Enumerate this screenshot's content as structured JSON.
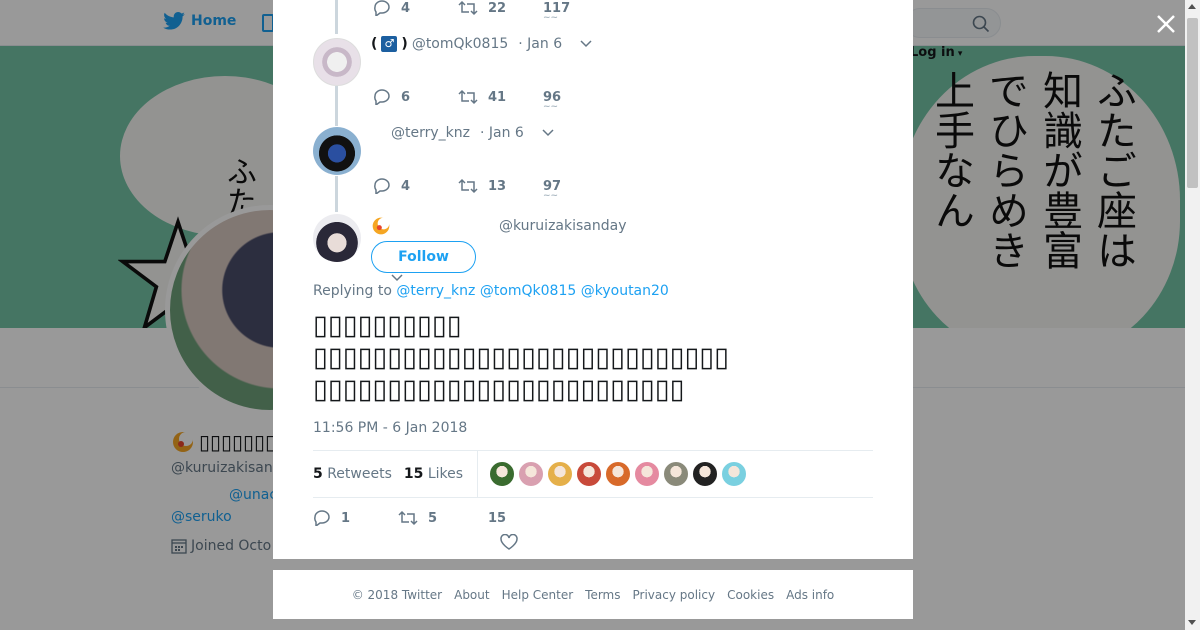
{
  "background": {
    "nav": {
      "home_label": "Home",
      "login_label": "Log in"
    },
    "banner_text_left": "ふた",
    "banner_text_right_cols": [
      "ふたご座は",
      "知識が豊富",
      "でひらめき",
      "上手なん"
    ],
    "profile": {
      "name_suffix": "▯▯▯▯▯▯▯",
      "handle": "@kuruizakisan",
      "link1": "@unac",
      "link2": "@seruko",
      "joined": "Joined Octo"
    }
  },
  "thread": {
    "top_actions": {
      "replies": "4",
      "retweets": "22",
      "likes": "117"
    },
    "reply1": {
      "gender_symbol": "♂",
      "handle": "@tomQk0815",
      "date": "· Jan 6",
      "replies": "6",
      "retweets": "41",
      "likes": "96"
    },
    "reply2": {
      "handle": "@terry_knz",
      "date": "· Jan 6",
      "replies": "4",
      "retweets": "13",
      "likes": "97"
    }
  },
  "tweet": {
    "handle": "@kuruizakisanday",
    "follow_label": "Follow",
    "replying_prefix": "Replying to",
    "replying_to": [
      "@terry_knz",
      "@tomQk0815",
      "@kyoutan20"
    ],
    "text": "▯▯▯▯▯▯▯▯▯▯\n▯▯▯▯▯▯▯▯▯▯▯▯▯▯▯▯▯▯▯▯▯▯▯▯▯▯▯▯\n▯▯▯▯▯▯▯▯▯▯▯▯▯▯▯▯▯▯▯▯▯▯▯▯▯",
    "timestamp": "11:56 PM - 6 Jan 2018",
    "retweets_count": "5",
    "retweets_label": "Retweets",
    "likes_count": "15",
    "likes_label": "Likes",
    "liker_colors": [
      "#3a6b2f",
      "#d9a0b0",
      "#e5b04a",
      "#c84a3a",
      "#d86a2a",
      "#e58aa0",
      "#8a8a7a",
      "#222222",
      "#7ad0e0"
    ],
    "actions": {
      "replies": "1",
      "retweets": "5",
      "likes": "15"
    }
  },
  "footer": {
    "links": [
      "© 2018 Twitter",
      "About",
      "Help Center",
      "Terms",
      "Privacy policy",
      "Cookies",
      "Ads info"
    ]
  },
  "colors": {
    "accent": "#1da1f2",
    "muted": "#657786",
    "text": "#14171a",
    "overlay": "rgba(0,0,0,0.4)"
  }
}
